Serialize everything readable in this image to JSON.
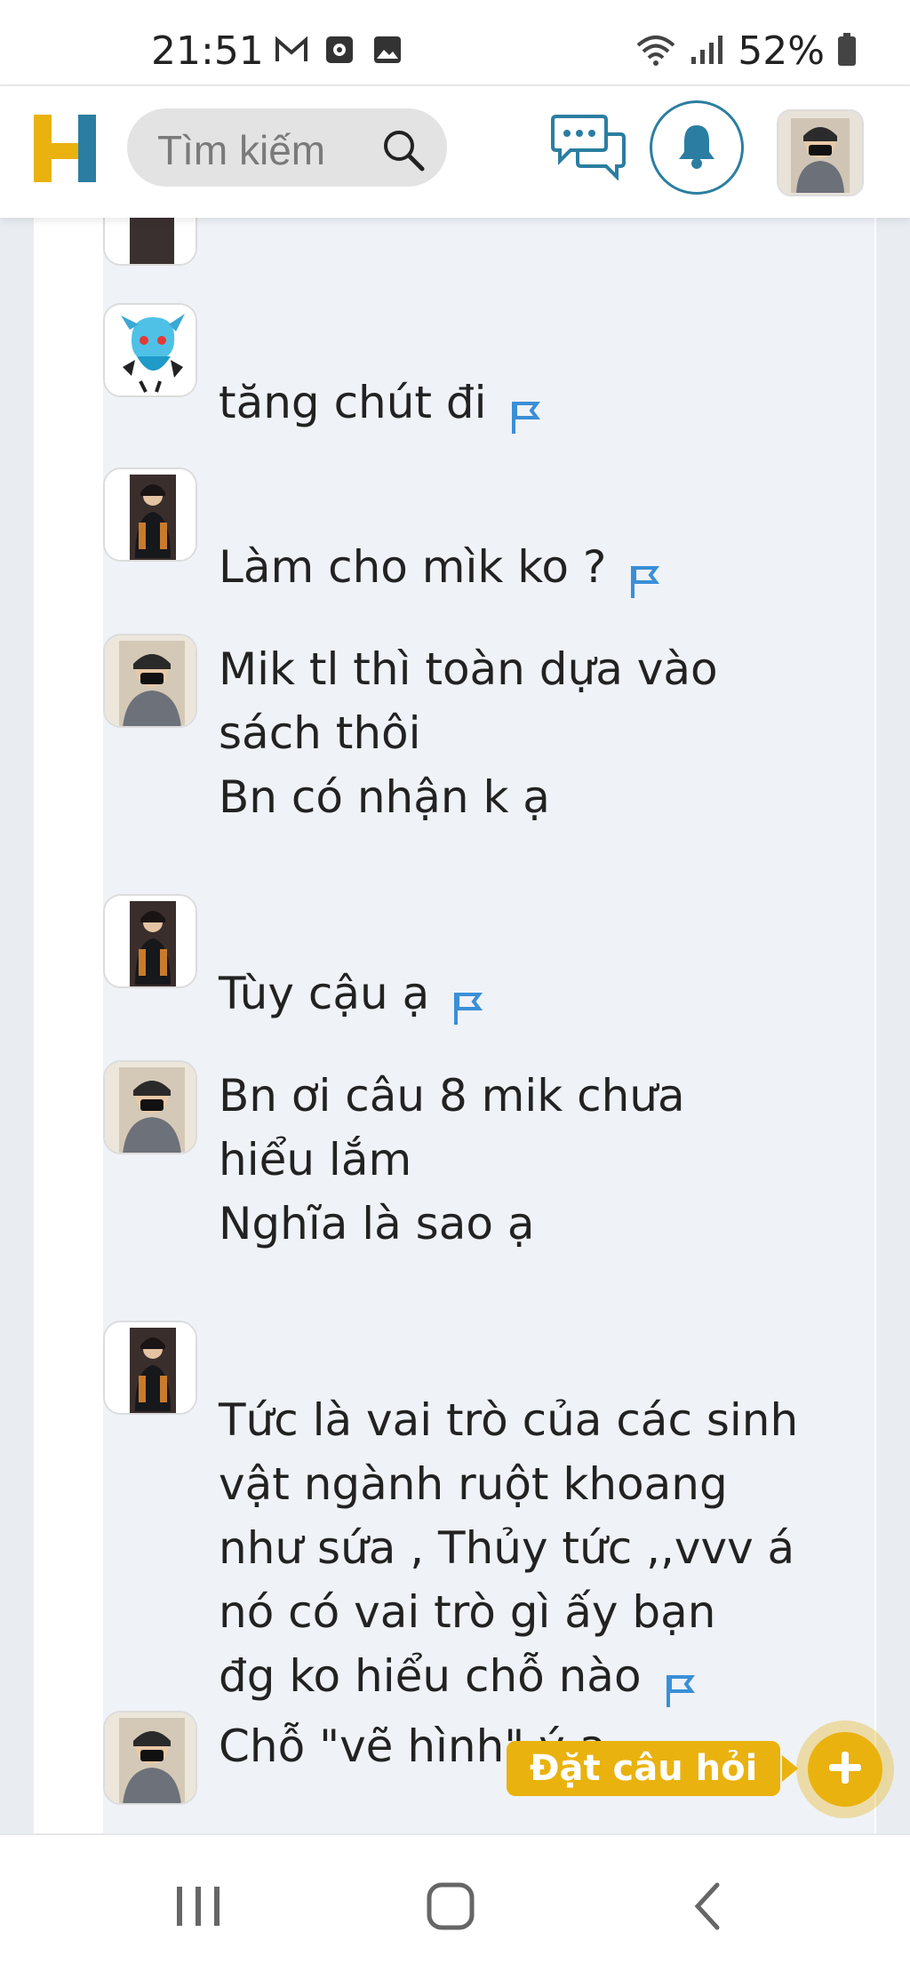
{
  "status_bar": {
    "time": "21:51",
    "left_icons": [
      "gmail-icon",
      "screen-record-icon",
      "gallery-icon"
    ],
    "battery_text": "52%",
    "right_icons": [
      "wifi-icon",
      "signal-icon",
      "battery-icon"
    ]
  },
  "header": {
    "logo_icon": "hoc24-logo",
    "search_placeholder": "Tìm kiếm",
    "chat_icon": "chat-bubbles-icon",
    "bell_icon": "bell-icon",
    "accent_color": "#2b7ea1",
    "brand_yellow": "#e9b20e"
  },
  "messages": [
    {
      "text": "tăng chút đi",
      "avatar": "avatar-anime-blue",
      "flag": true
    },
    {
      "text": "Làm cho mìk ko ?",
      "avatar": "avatar-dark-figure",
      "flag": true
    },
    {
      "text": "Mik tl thì toàn dựa vào\nsách thôi\n Bn có nhận k ạ",
      "avatar": "avatar-masked-person",
      "flag": false
    },
    {
      "text": "Tùy cậu ạ",
      "avatar": "avatar-dark-figure",
      "flag": true
    },
    {
      "text": "Bn ơi câu 8 mik chưa\nhiểu lắm\nNghĩa là sao ạ",
      "avatar": "avatar-masked-person",
      "flag": false
    },
    {
      "text": "Tức là vai trò của các sinh\nvật ngành ruột khoang\nnhư sứa , Thủy tức ,,vvv á\nnó có vai trò gì ấy bạn\nđg ko hiểu chỗ nào",
      "avatar": "avatar-dark-figure",
      "flag": true
    },
    {
      "text": "Chỗ \"vẽ hình\" ý ạ",
      "avatar": "avatar-masked-person",
      "flag": false
    }
  ],
  "ask_button": {
    "label": "Đặt câu hỏi",
    "icon": "plus-icon"
  },
  "nav_bar": {
    "items": [
      "recent-apps-icon",
      "home-icon",
      "back-icon"
    ]
  }
}
